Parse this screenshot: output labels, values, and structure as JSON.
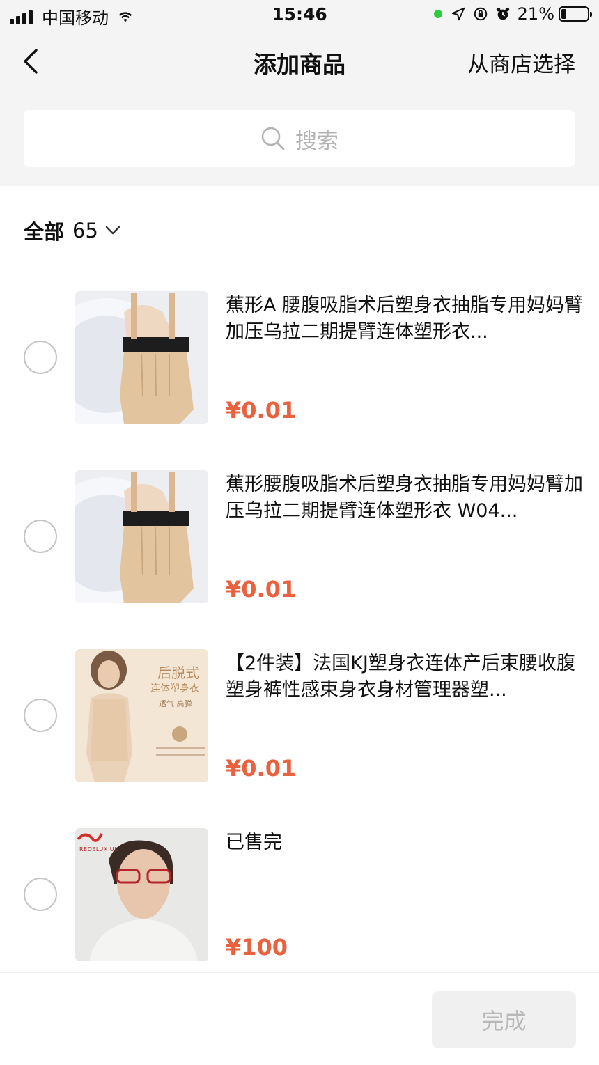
{
  "status_bar": {
    "carrier": "中国移动",
    "time": "15:46",
    "battery": "21%"
  },
  "nav": {
    "title": "添加商品",
    "right_action": "从商店选择"
  },
  "search": {
    "placeholder": "搜索"
  },
  "filter": {
    "label": "全部",
    "count": "65"
  },
  "products": [
    {
      "title": "蕉形A 腰腹吸脂术后塑身衣抽脂专用妈妈臂加压乌拉二期提臂连体塑形衣...",
      "price": "¥0.01"
    },
    {
      "title": "蕉形腰腹吸脂术后塑身衣抽脂专用妈妈臂加压乌拉二期提臂连体塑形衣 W04...",
      "price": "¥0.01"
    },
    {
      "title": "【2件装】法国KJ塑身衣连体产后束腰收腹塑身裤性感束身衣身材管理器塑...",
      "price": "¥0.01"
    },
    {
      "title": "已售完",
      "price": "¥100"
    }
  ],
  "thumb_text": {
    "p3_heading_1": "后脱式",
    "p3_heading_2": "连体塑身衣",
    "p3_sub": "透气 高弹",
    "p4_logo": "REDELUX UK"
  },
  "footer": {
    "done_label": "完成"
  },
  "colors": {
    "price": "#e8623f",
    "background_top": "#f4f4f4"
  }
}
